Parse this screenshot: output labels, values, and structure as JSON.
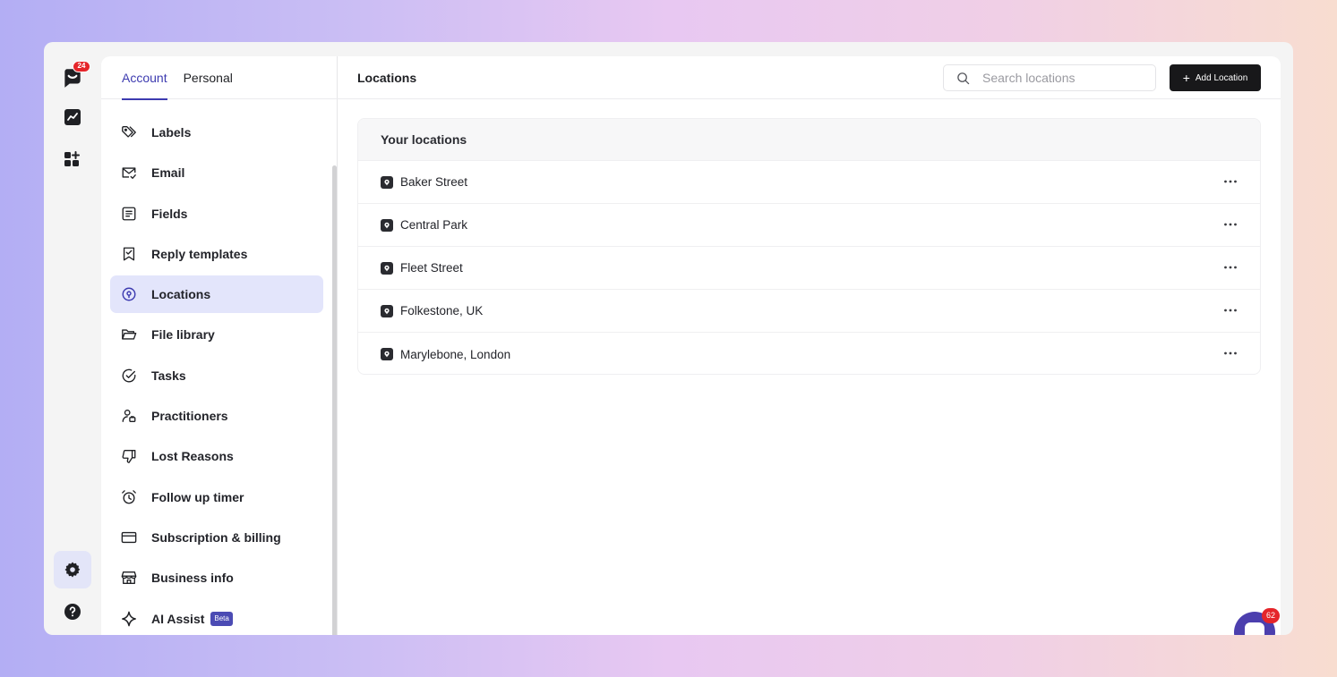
{
  "rail": {
    "notification_count": "24",
    "items": [
      {
        "icon": "chat-logo-icon"
      },
      {
        "icon": "analytics-icon"
      },
      {
        "icon": "apps-add-icon"
      },
      {
        "icon": "gear-icon"
      },
      {
        "icon": "help-icon"
      }
    ]
  },
  "sidebar": {
    "tabs": [
      {
        "label": "Account",
        "active": true
      },
      {
        "label": "Personal",
        "active": false
      }
    ],
    "items": [
      {
        "label": "Labels",
        "icon": "tag-icon"
      },
      {
        "label": "Email",
        "icon": "mail-icon"
      },
      {
        "label": "Fields",
        "icon": "form-fields-icon"
      },
      {
        "label": "Reply templates",
        "icon": "bookmark-check-icon"
      },
      {
        "label": "Locations",
        "icon": "location-pin-icon",
        "active": true
      },
      {
        "label": "File library",
        "icon": "folder-icon"
      },
      {
        "label": "Tasks",
        "icon": "check-circle-icon"
      },
      {
        "label": "Practitioners",
        "icon": "user-badge-icon"
      },
      {
        "label": "Lost Reasons",
        "icon": "thumbs-down-icon"
      },
      {
        "label": "Follow up timer",
        "icon": "alarm-clock-icon"
      },
      {
        "label": "Subscription & billing",
        "icon": "credit-card-icon"
      },
      {
        "label": "Business info",
        "icon": "storefront-icon"
      },
      {
        "label": "AI Assist",
        "icon": "sparkle-icon",
        "badge": "Beta"
      }
    ]
  },
  "header": {
    "title": "Locations",
    "search_placeholder": "Search locations",
    "add_button_label": "Add Location"
  },
  "locations": {
    "title": "Your locations",
    "rows": [
      {
        "name": "Baker Street"
      },
      {
        "name": "Central Park"
      },
      {
        "name": "Fleet Street"
      },
      {
        "name": "Folkestone, UK"
      },
      {
        "name": "Marylebone, London"
      }
    ]
  },
  "chat_widget": {
    "unread_count": "62"
  },
  "colors": {
    "accent": "#3d3bb0",
    "active_bg": "#e3e5fb",
    "badge": "#e5252a",
    "primary_button": "#18181a"
  }
}
